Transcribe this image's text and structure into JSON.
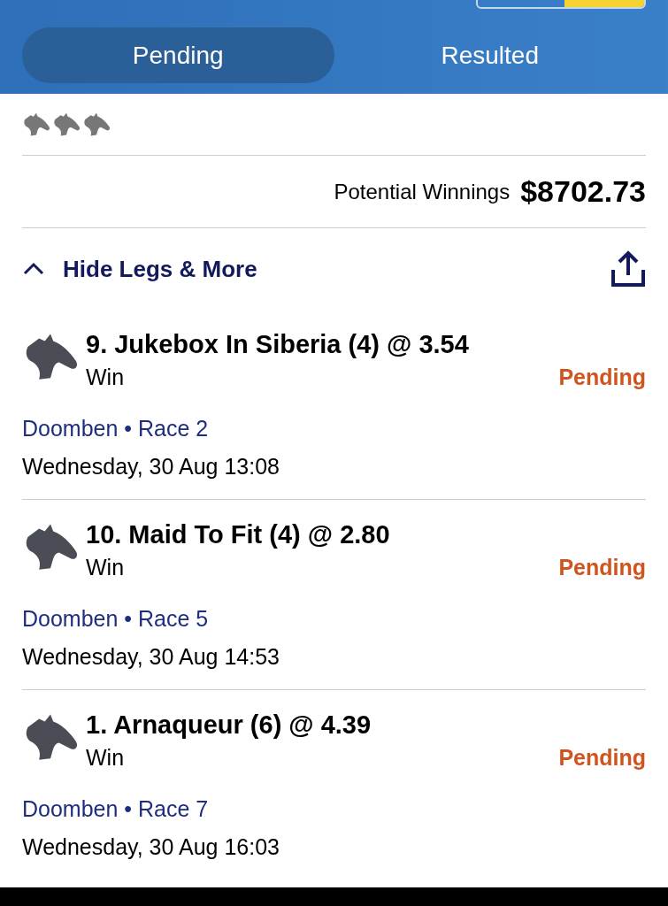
{
  "tabs": [
    {
      "label": "Pending",
      "selected": true
    },
    {
      "label": "Resulted",
      "selected": false
    }
  ],
  "summary": {
    "potential_label": "Potential Winnings",
    "potential_value": "$8702.73"
  },
  "toggle": {
    "label": "Hide Legs & More",
    "expanded": true
  },
  "legs": [
    {
      "title": "9. Jukebox In Siberia (4) @ 3.54",
      "bet_type": "Win",
      "status": "Pending",
      "venue": "Doomben • Race 2",
      "time": "Wednesday, 30 Aug 13:08"
    },
    {
      "title": "10. Maid To Fit (4) @ 2.80",
      "bet_type": "Win",
      "status": "Pending",
      "venue": "Doomben • Race 5",
      "time": "Wednesday, 30 Aug 14:53"
    },
    {
      "title": "1. Arnaqueur (6) @ 4.39",
      "bet_type": "Win",
      "status": "Pending",
      "venue": "Doomben • Race 7",
      "time": "Wednesday, 30 Aug 16:03"
    }
  ]
}
